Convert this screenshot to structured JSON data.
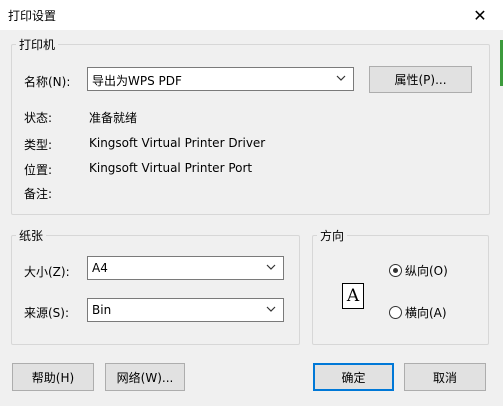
{
  "window": {
    "title": "打印设置",
    "close": "✕"
  },
  "printer": {
    "group_label": "打印机",
    "name_label": "名称(N):",
    "name_value": "导出为WPS PDF",
    "properties_button": "属性(P)...",
    "status_label": "状态:",
    "status_value": "准备就绪",
    "type_label": "类型:",
    "type_value": "Kingsoft Virtual Printer Driver",
    "location_label": "位置:",
    "location_value": "Kingsoft Virtual Printer Port",
    "comment_label": "备注:",
    "comment_value": ""
  },
  "paper": {
    "group_label": "纸张",
    "size_label": "大小(Z):",
    "size_value": "A4",
    "source_label": "来源(S):",
    "source_value": "Bin"
  },
  "orientation": {
    "group_label": "方向",
    "icon_letter": "A",
    "portrait_label": "纵向(O)",
    "landscape_label": "横向(A)",
    "selected": "portrait"
  },
  "buttons": {
    "help": "帮助(H)",
    "network": "网络(W)...",
    "ok": "确定",
    "cancel": "取消"
  }
}
